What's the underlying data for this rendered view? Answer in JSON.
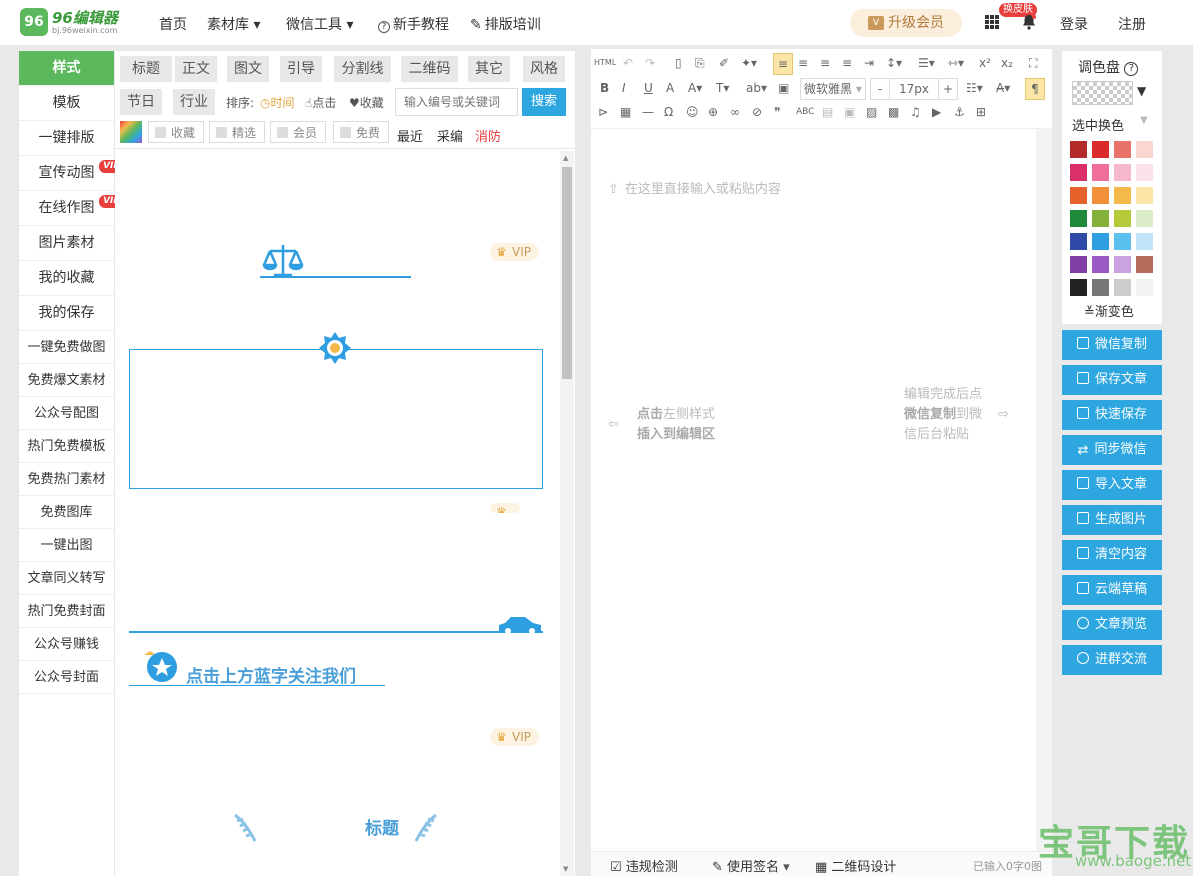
{
  "brand": {
    "logo_mark": "96",
    "name": "96编辑器",
    "url": "bj.96weixin.com"
  },
  "topnav": {
    "items": [
      {
        "label": "首页"
      },
      {
        "label": "素材库 ▾"
      },
      {
        "label": "微信工具 ▾"
      },
      {
        "label": "新手教程"
      },
      {
        "label": "排版培训"
      }
    ],
    "upgrade_label": "升级会员",
    "skin_badge": "换皮肤",
    "login": "登录",
    "register": "注册"
  },
  "sidebar": {
    "items": [
      {
        "label": "样式",
        "active": true
      },
      {
        "label": "模板"
      },
      {
        "label": "一键排版"
      },
      {
        "label": "宣传动图",
        "badge": "VIP"
      },
      {
        "label": "在线作图",
        "badge": "VIP"
      },
      {
        "label": "图片素材"
      },
      {
        "label": "我的收藏"
      },
      {
        "label": "我的保存"
      },
      {
        "label": "一键免费做图"
      },
      {
        "label": "免费爆文素材"
      },
      {
        "label": "公众号配图"
      },
      {
        "label": "热门免费模板"
      },
      {
        "label": "免费热门素材"
      },
      {
        "label": "免费图库"
      },
      {
        "label": "一键出图"
      },
      {
        "label": "文章同义转写"
      },
      {
        "label": "热门免费封面"
      },
      {
        "label": "公众号赚钱"
      },
      {
        "label": "公众号封面"
      }
    ]
  },
  "materials": {
    "categories_row1": [
      "标题",
      "正文",
      "图文",
      "引导",
      "分割线",
      "二维码",
      "其它",
      "风格"
    ],
    "categories_row2": [
      "节日",
      "行业"
    ],
    "sort_label": "排序:",
    "sort_options": [
      "时间",
      "点击",
      "收藏"
    ],
    "search_placeholder": "输入编号或关键词",
    "search_button": "搜索",
    "filters": [
      "收藏",
      "精选",
      "会员",
      "免费"
    ],
    "links": [
      "最近",
      "采编",
      "消防"
    ],
    "vip_label": "VIP",
    "follow_text": "点击上方蓝字关注我们",
    "title_sample": "标题"
  },
  "editor": {
    "html_label": "HTML",
    "font_name": "微软雅黑",
    "font_size": "17px",
    "placeholder_top": "在这里直接输入或粘贴内容",
    "hint_left_bold1": "点击",
    "hint_left_rest1": "左侧样式",
    "hint_left_bold2": "插入到编辑区",
    "hint_right_1": "编辑完成后点",
    "hint_right_bold": "微信复制",
    "hint_right_2": "到微",
    "hint_right_3": "信后台粘贴",
    "footer": [
      "违规检测",
      "使用签名",
      "二维码设计"
    ],
    "counter": "已输入0字0图"
  },
  "palette": {
    "title": "调色盘",
    "help": "?",
    "select_label": "选中换色",
    "gradient_label": "渐变色",
    "swatches": [
      "#b32a2a",
      "#d92b2b",
      "#e8736b",
      "#f9d6cf",
      "#d9306a",
      "#ef6f99",
      "#f5b8cd",
      "#fbe1ea",
      "#e6602b",
      "#f2913a",
      "#f5b94a",
      "#fbe6a8",
      "#1e8a3a",
      "#84b13a",
      "#b5c93a",
      "#dcebc8",
      "#2f4aa6",
      "#2e9ee0",
      "#5cc0ee",
      "#bfe4f7",
      "#7f3fa6",
      "#9a5ac4",
      "#c9a2df",
      "#b56a5a",
      "#222222",
      "#777777",
      "#cccccc",
      "#f2f2f2"
    ]
  },
  "actions": [
    "微信复制",
    "保存文章",
    "快速保存",
    "同步微信",
    "导入文章",
    "生成图片",
    "清空内容",
    "云端草稿",
    "文章预览",
    "进群交流"
  ],
  "watermark": {
    "text": "宝哥下载",
    "url": "www.baoge.net"
  },
  "colors": {
    "green": "#5cb85c",
    "blue": "#2ea7e0",
    "red": "#e83e3e",
    "accent_line": "#4a9fd8"
  }
}
